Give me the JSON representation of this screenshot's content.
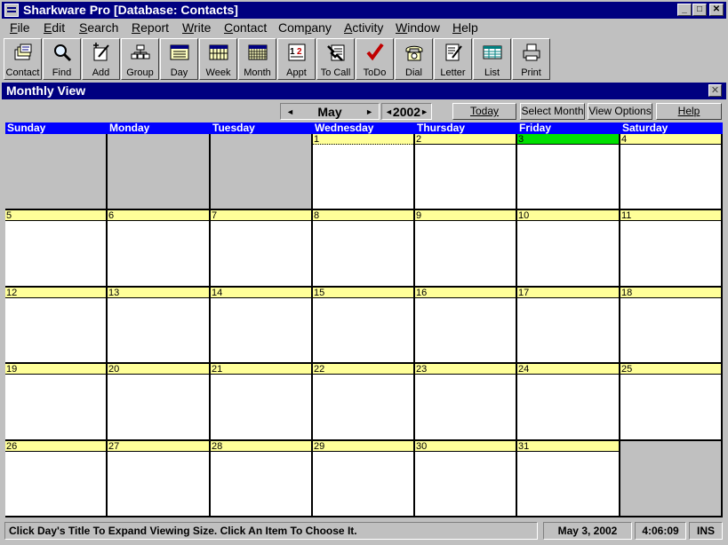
{
  "window": {
    "title": "Sharkware Pro  [Database: Contacts]",
    "min_label": "_",
    "max_label": "□",
    "close_label": "✕"
  },
  "menu": [
    {
      "first": "F",
      "rest": "ile"
    },
    {
      "first": "E",
      "rest": "dit"
    },
    {
      "first": "S",
      "rest": "earch"
    },
    {
      "first": "R",
      "rest": "eport"
    },
    {
      "first": "W",
      "rest": "rite"
    },
    {
      "first": "C",
      "rest": "ontact"
    },
    {
      "first": "",
      "rest": "Company",
      "u": "p",
      "before": "Com",
      "after": "any"
    },
    {
      "first": "A",
      "rest": "ctivity"
    },
    {
      "first": "W",
      "rest": "indow"
    },
    {
      "first": "H",
      "rest": "elp"
    }
  ],
  "toolbar": [
    {
      "label": "Contact",
      "icon": "contact-cards-icon"
    },
    {
      "label": "Find",
      "icon": "magnifier-icon"
    },
    {
      "label": "Add",
      "icon": "add-pencil-icon"
    },
    {
      "label": "Group",
      "icon": "group-icon"
    },
    {
      "label": "Day",
      "icon": "day-calendar-icon"
    },
    {
      "label": "Week",
      "icon": "week-calendar-icon"
    },
    {
      "label": "Month",
      "icon": "month-calendar-icon"
    },
    {
      "label": "Appt",
      "icon": "appointment-icon"
    },
    {
      "label": "To Call",
      "icon": "to-call-icon"
    },
    {
      "label": "ToDo",
      "icon": "checkmark-icon"
    },
    {
      "label": "Dial",
      "icon": "phone-icon"
    },
    {
      "label": "Letter",
      "icon": "letter-icon"
    },
    {
      "label": "List",
      "icon": "list-icon"
    },
    {
      "label": "Print",
      "icon": "printer-icon"
    }
  ],
  "monthly_view": {
    "title": "Monthly View",
    "close_label": "✕",
    "month": "May",
    "year": "2002",
    "prev_month": "◄",
    "next_month": "►",
    "prev_year": "◄",
    "next_year": "►",
    "buttons": {
      "today": "Today",
      "select_month": "Select Month",
      "view_options": "View Options",
      "help": "Help"
    },
    "days": [
      "Sunday",
      "Monday",
      "Tuesday",
      "Wednesday",
      "Thursday",
      "Friday",
      "Saturday"
    ],
    "first_weekday": 3,
    "num_days": 31,
    "today": 3,
    "selected": 1,
    "colors": {
      "day_header": "#0000ff",
      "date_strip": "#ffff99",
      "today_strip": "#00e000",
      "title_bar": "#000080"
    }
  },
  "status": {
    "hint": "Click Day's Title To Expand Viewing Size.  Click An Item To Choose It.",
    "date": "May 3, 2002",
    "time": "4:06:09",
    "mode": "INS"
  }
}
